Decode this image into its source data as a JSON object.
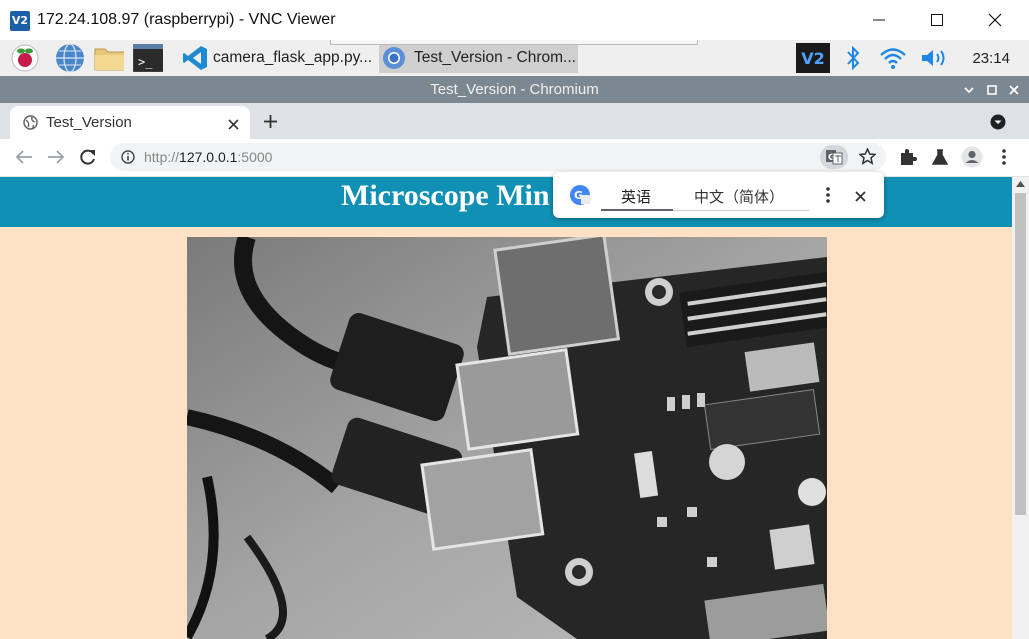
{
  "vnc": {
    "logo_text": "V2",
    "title": "172.24.108.97 (raspberrypi) - VNC Viewer"
  },
  "taskbar": {
    "tasks": [
      {
        "label": "camera_flask_app.py..."
      },
      {
        "label": "Test_Version - Chrom..."
      }
    ],
    "clock": "23:14",
    "vnc_tray_text": "V2"
  },
  "chromium": {
    "window_title": "Test_Version - Chromium",
    "tab": {
      "title": "Test_Version"
    },
    "url": {
      "scheme": "http://",
      "host": "127.0.0.1",
      "port": ":5000"
    }
  },
  "translate_popup": {
    "source_lang": "英语",
    "target_lang": "中文（简体）"
  },
  "page": {
    "heading": "Microscope Min",
    "header_color": "#1090b4",
    "background_color": "#ffe2c6"
  },
  "icons": {
    "taskbar": [
      "raspberry-menu-icon",
      "web-browser-icon",
      "file-manager-icon",
      "terminal-icon",
      "vscode-icon",
      "chromium-icon"
    ],
    "tray": [
      "vnc-server-icon",
      "bluetooth-icon",
      "wifi-icon",
      "volume-icon"
    ]
  }
}
